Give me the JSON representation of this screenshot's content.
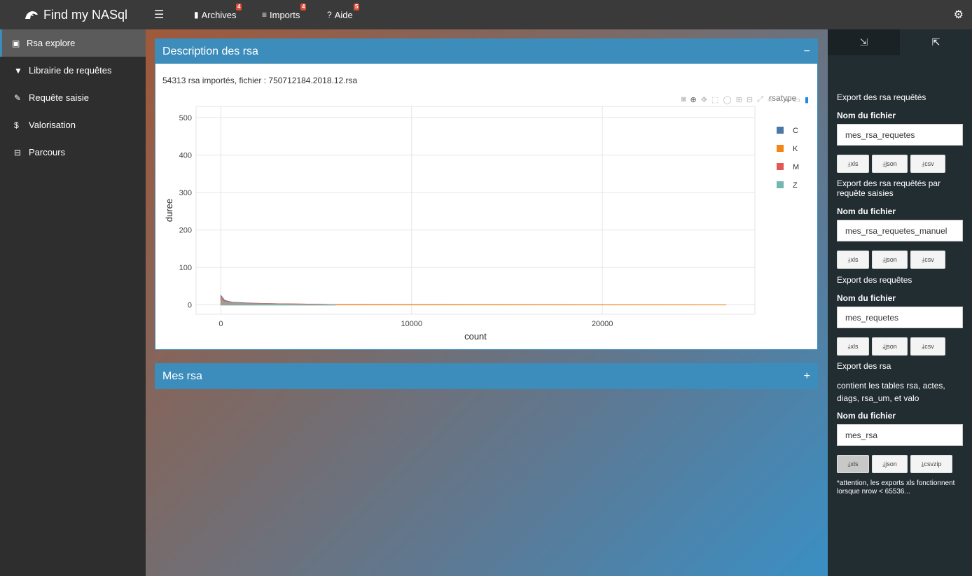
{
  "header": {
    "app_title": "Find my NASql",
    "nav": [
      {
        "label": "Archives",
        "badge": "4"
      },
      {
        "label": "Imports",
        "badge": "4"
      },
      {
        "label": "Aide",
        "badge": "5"
      }
    ]
  },
  "sidebar": {
    "items": [
      {
        "label": "Rsa explore",
        "icon": "clipboard-check-icon"
      },
      {
        "label": "Librairie de requêtes",
        "icon": "filter-icon"
      },
      {
        "label": "Requête saisie",
        "icon": "broom-icon"
      },
      {
        "label": "Valorisation",
        "icon": "dollar-icon"
      },
      {
        "label": "Parcours",
        "icon": "bed-icon"
      }
    ]
  },
  "main": {
    "box1": {
      "title": "Description des rsa",
      "tool": "−",
      "info": "54313 rsa importés, fichier : 750712184.2018.12.rsa"
    },
    "box2": {
      "title": "Mes rsa",
      "tool": "+"
    }
  },
  "chart_data": {
    "type": "area",
    "xlabel": "count",
    "ylabel": "duree",
    "x_ticks": [
      "0",
      "10000",
      "20000"
    ],
    "y_ticks": [
      "0",
      "100",
      "200",
      "300",
      "400",
      "500"
    ],
    "xlim": [
      -1300,
      28000
    ],
    "ylim": [
      -25,
      530
    ],
    "legend_title": "rsatype",
    "legend_position": "top-right",
    "grid": true,
    "series": [
      {
        "name": "C",
        "color": "#4c78a8",
        "x": [
          0,
          200,
          600,
          1500,
          3000,
          4500,
          6000
        ],
        "y": [
          25,
          12,
          7,
          5,
          3,
          2,
          1
        ]
      },
      {
        "name": "K",
        "color": "#f58518",
        "x": [
          0,
          200,
          600,
          1500,
          3000,
          4500,
          6000,
          26500
        ],
        "y": [
          15,
          9,
          6,
          4,
          3,
          2,
          1,
          0
        ]
      },
      {
        "name": "M",
        "color": "#e45756",
        "x": [
          0,
          200,
          600,
          1500,
          3000,
          4500,
          6000
        ],
        "y": [
          20,
          10,
          6,
          4,
          3,
          2,
          1
        ]
      },
      {
        "name": "Z",
        "color": "#72b7b2",
        "x": [
          0,
          200,
          600,
          1500,
          3000,
          4500,
          6000
        ],
        "y": [
          12,
          8,
          5,
          3,
          2,
          1,
          1
        ]
      }
    ]
  },
  "control": {
    "sections": [
      {
        "title": "Export des rsa requêtés",
        "field_label": "Nom du fichier",
        "value": "mes_rsa_requetes",
        "buttons": [
          "xls",
          "json",
          "csv"
        ]
      },
      {
        "title": "Export des rsa requêtés par requête saisies",
        "field_label": "Nom du fichier",
        "value": "mes_rsa_requetes_manuel",
        "buttons": [
          "xls",
          "json",
          "csv"
        ]
      },
      {
        "title": "Export des requêtes",
        "field_label": "Nom du fichier",
        "value": "mes_requetes",
        "buttons": [
          "xls",
          "json",
          "csv"
        ]
      },
      {
        "title": "Export des rsa",
        "description": "contient les tables rsa, actes, diags, rsa_um, et valo",
        "field_label": "Nom du fichier",
        "value": "mes_rsa",
        "buttons": [
          "xls",
          "json",
          "csvzip"
        ]
      }
    ],
    "note": "*attention, les exports xls fonctionnent lorsque nrow < 65536..."
  }
}
